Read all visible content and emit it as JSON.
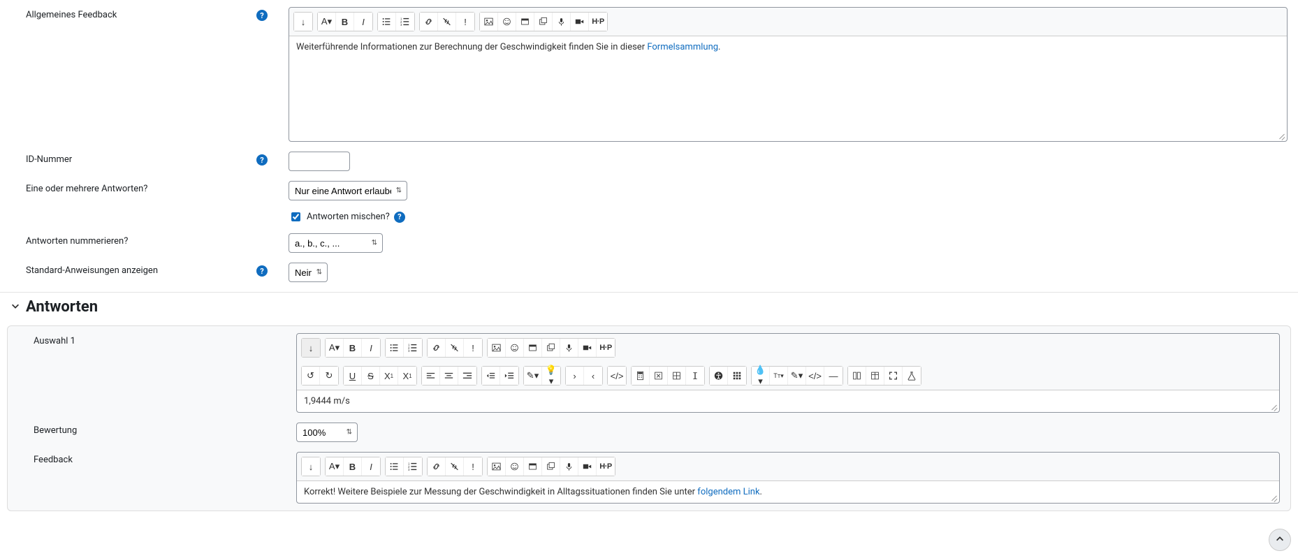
{
  "general": {
    "feedback_label": "Allgemeines Feedback",
    "feedback_text_prefix": "Weiterführende Informationen zur Berechnung der Geschwindigkeit finden Sie in dieser ",
    "feedback_link_text": "Formelsammlung",
    "feedback_text_suffix": ".",
    "idnumber_label": "ID-Nummer",
    "idnumber_value": "",
    "answers_mode_label": "Eine oder mehrere Antworten?",
    "answers_mode_value": "Nur eine Antwort erlauben",
    "shuffle_label": "Antworten mischen?",
    "shuffle_checked": true,
    "numbering_label": "Antworten nummerieren?",
    "numbering_value": "a., b., c., ...",
    "stdinstr_label": "Standard-Anweisungen anzeigen",
    "stdinstr_value": "Nein"
  },
  "answers_section": {
    "title": "Antworten",
    "choice1_label": "Auswahl 1",
    "choice1_text": "1,9444 m/s",
    "grade_label": "Bewertung",
    "grade_value": "100%",
    "feedback_label": "Feedback",
    "feedback_text_prefix": "Korrekt! Weitere Beispiele zur Messung der Geschwindigkeit in Alltagssituationen finden Sie unter ",
    "feedback_link_text": "folgendem Link",
    "feedback_text_suffix": "."
  },
  "icons": {
    "expand": "↓",
    "h5p": "H·P"
  }
}
